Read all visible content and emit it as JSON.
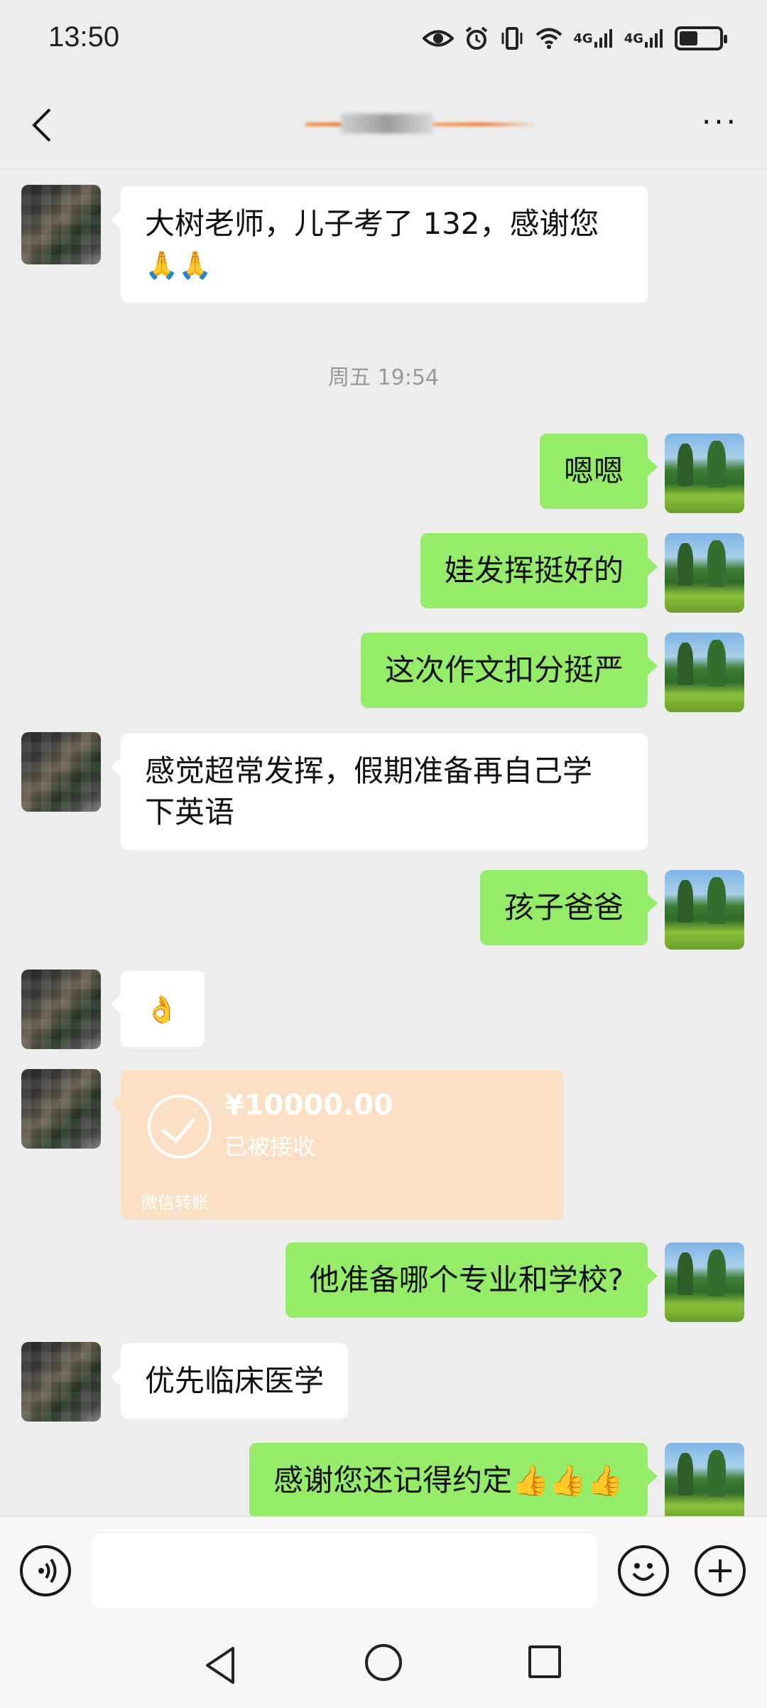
{
  "status_bar": {
    "time": "13:50",
    "icons": [
      "eye-icon",
      "alarm-icon",
      "vibrate-icon",
      "wifi-icon",
      "signal-4g-icon",
      "signal-4g-icon",
      "battery-icon"
    ],
    "network_label_1": "4G",
    "network_label_2": "4G"
  },
  "nav": {
    "back_icon": "chevron-left-icon",
    "more_icon": "more-icon",
    "more_label": "···"
  },
  "messages": [
    {
      "side": "them",
      "text_1": "大树老师，儿子考了 132，感谢您",
      "text_2": "🙏🙏"
    },
    {
      "side": "timestamp",
      "text": "周五 19:54"
    },
    {
      "side": "me",
      "text": "嗯嗯"
    },
    {
      "side": "me",
      "text": "娃发挥挺好的"
    },
    {
      "side": "me",
      "text": "这次作文扣分挺严"
    },
    {
      "side": "them",
      "text_1": "感觉超常发挥，假期准备再自己学",
      "text_2": "下英语"
    },
    {
      "side": "me",
      "text": "孩子爸爸"
    },
    {
      "side": "them",
      "text": "👌"
    },
    {
      "side": "transfer",
      "amount": "¥10000.00",
      "status": "已被接收",
      "label": "微信转账"
    },
    {
      "side": "me",
      "text": "他准备哪个专业和学校?"
    },
    {
      "side": "them",
      "text": "优先临床医学"
    },
    {
      "side": "me",
      "text": "感谢您还记得约定👍👍👍"
    }
  ],
  "input_bar": {
    "voice_icon": "voice-icon",
    "emoji_icon": "emoji-icon",
    "plus_icon": "plus-icon",
    "placeholder": ""
  },
  "system_nav": [
    "back-triangle-icon",
    "home-circle-icon",
    "recent-square-icon"
  ]
}
